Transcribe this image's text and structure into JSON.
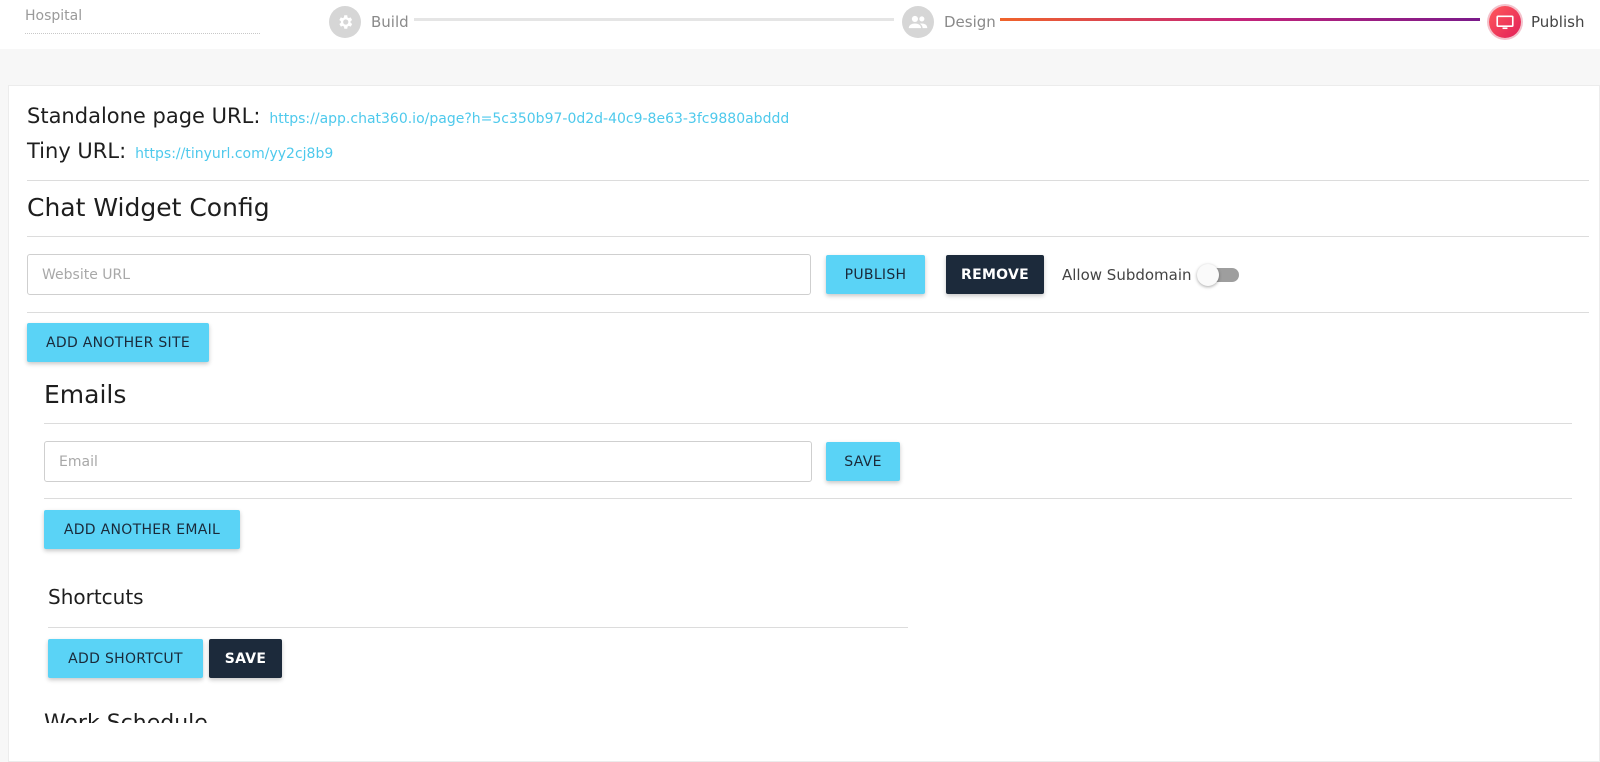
{
  "header": {
    "project_name": "Hospital",
    "steps": [
      {
        "label": "Build",
        "icon": "gear-icon",
        "state": "done"
      },
      {
        "label": "Design",
        "icon": "people-icon",
        "state": "done"
      },
      {
        "label": "Publish",
        "icon": "monitor-icon",
        "state": "active"
      }
    ]
  },
  "urls": {
    "standalone_label": "Standalone page URL:",
    "standalone_value": "https://app.chat360.io/page?h=5c350b97-0d2d-40c9-8e63-3fc9880abddd",
    "tiny_label": "Tiny URL:",
    "tiny_value": "https://tinyurl.com/yy2cj8b9"
  },
  "widget_config": {
    "title": "Chat Widget Config",
    "website_placeholder": "Website URL",
    "website_value": "",
    "publish_label": "PUBLISH",
    "remove_label": "REMOVE",
    "allow_subdomain_label": "Allow Subdomain",
    "allow_subdomain_on": false,
    "add_site_label": "ADD ANOTHER SITE"
  },
  "emails": {
    "title": "Emails",
    "email_placeholder": "Email",
    "email_value": "",
    "save_label": "SAVE",
    "add_email_label": "ADD ANOTHER EMAIL"
  },
  "shortcuts": {
    "title": "Shortcuts",
    "add_label": "ADD SHORTCUT",
    "save_label": "SAVE"
  },
  "next_section": {
    "title": "Work Schedule"
  },
  "colors": {
    "accent": "#5ad3f6",
    "dark_button": "#1c2a3b",
    "link": "#4ec9ec",
    "progress_start": "#f0642a",
    "progress_end": "#7a1a8a"
  }
}
